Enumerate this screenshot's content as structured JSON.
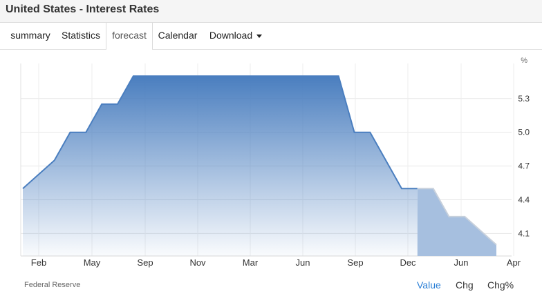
{
  "header": {
    "title": "United States - Interest Rates"
  },
  "tabs": [
    {
      "label": "summary"
    },
    {
      "label": "Statistics"
    },
    {
      "label": "forecast"
    },
    {
      "label": "Calendar"
    },
    {
      "label": "Download"
    }
  ],
  "active_tab": "forecast",
  "footer": {
    "source": "Federal Reserve",
    "options": [
      "Value",
      "Chg",
      "Chg%"
    ],
    "selected_option": "Value"
  },
  "colors": {
    "actual_line": "#4a7ebf",
    "actual_fill_top": "#4a7ebf",
    "forecast_fill": "#a6bfdf",
    "forecast_line": "#c7d0dc",
    "selected_option": "#2b7fd6"
  },
  "chart_data": {
    "type": "area",
    "ylabel": "%",
    "ylim": [
      3.9,
      5.55
    ],
    "yticks": [
      4.1,
      4.4,
      4.7,
      5.0,
      5.3
    ],
    "ytick_labels": [
      "4.1",
      "4.4",
      "4.7",
      "5.0",
      "5.3"
    ],
    "xtick_labels": [
      "Feb",
      "May",
      "Sep",
      "Nov",
      "Mar",
      "Jun",
      "Sep",
      "Dec",
      "Jun",
      "Apr"
    ],
    "grid": true,
    "series": [
      {
        "kind": "actual",
        "points": [
          {
            "x": "2022-12",
            "y": 4.5
          },
          {
            "x": "2023-02",
            "y": 4.75
          },
          {
            "x": "2023-03",
            "y": 5.0
          },
          {
            "x": "2023-04",
            "y": 5.0
          },
          {
            "x": "2023-05",
            "y": 5.25
          },
          {
            "x": "2023-06",
            "y": 5.25
          },
          {
            "x": "2023-07",
            "y": 5.5
          },
          {
            "x": "2024-08",
            "y": 5.5
          },
          {
            "x": "2024-09",
            "y": 5.0
          },
          {
            "x": "2024-10",
            "y": 5.0
          },
          {
            "x": "2024-12",
            "y": 4.5
          },
          {
            "x": "2025-01",
            "y": 4.5
          }
        ]
      },
      {
        "kind": "forecast",
        "points": [
          {
            "x": "2025-01",
            "y": 4.5
          },
          {
            "x": "2025-02",
            "y": 4.5
          },
          {
            "x": "2025-03",
            "y": 4.25
          },
          {
            "x": "2025-04",
            "y": 4.25
          },
          {
            "x": "2025-06",
            "y": 4.0
          }
        ]
      }
    ]
  }
}
